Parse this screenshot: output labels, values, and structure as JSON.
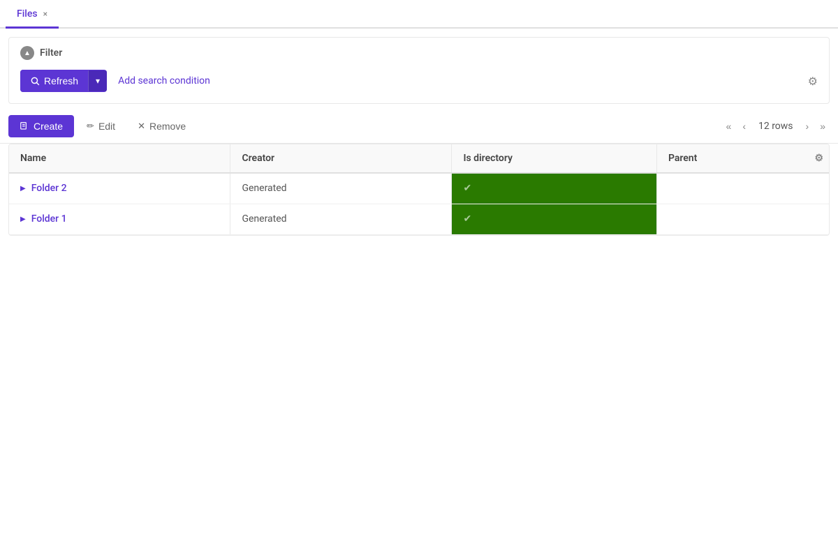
{
  "tab": {
    "label": "Files",
    "close_icon": "×"
  },
  "filter": {
    "title": "Filter",
    "toggle_icon": "▲",
    "refresh_label": "Refresh",
    "dropdown_icon": "▾",
    "add_search_label": "Add search condition",
    "gear_icon": "⚙"
  },
  "toolbar": {
    "create_label": "Create",
    "create_icon": "📄",
    "edit_icon": "✏",
    "edit_label": "Edit",
    "remove_icon": "✕",
    "remove_label": "Remove",
    "rows_label": "12 rows",
    "pagination": {
      "first": "«",
      "prev": "‹",
      "next": "›",
      "last": "»"
    }
  },
  "table": {
    "settings_icon": "⚙",
    "columns": [
      {
        "id": "name",
        "label": "Name"
      },
      {
        "id": "creator",
        "label": "Creator"
      },
      {
        "id": "is_directory",
        "label": "Is directory"
      },
      {
        "id": "parent",
        "label": "Parent"
      }
    ],
    "rows": [
      {
        "name": "Folder 2",
        "creator": "Generated",
        "is_directory": true,
        "parent": ""
      },
      {
        "name": "Folder 1",
        "creator": "Generated",
        "is_directory": true,
        "parent": ""
      }
    ]
  }
}
